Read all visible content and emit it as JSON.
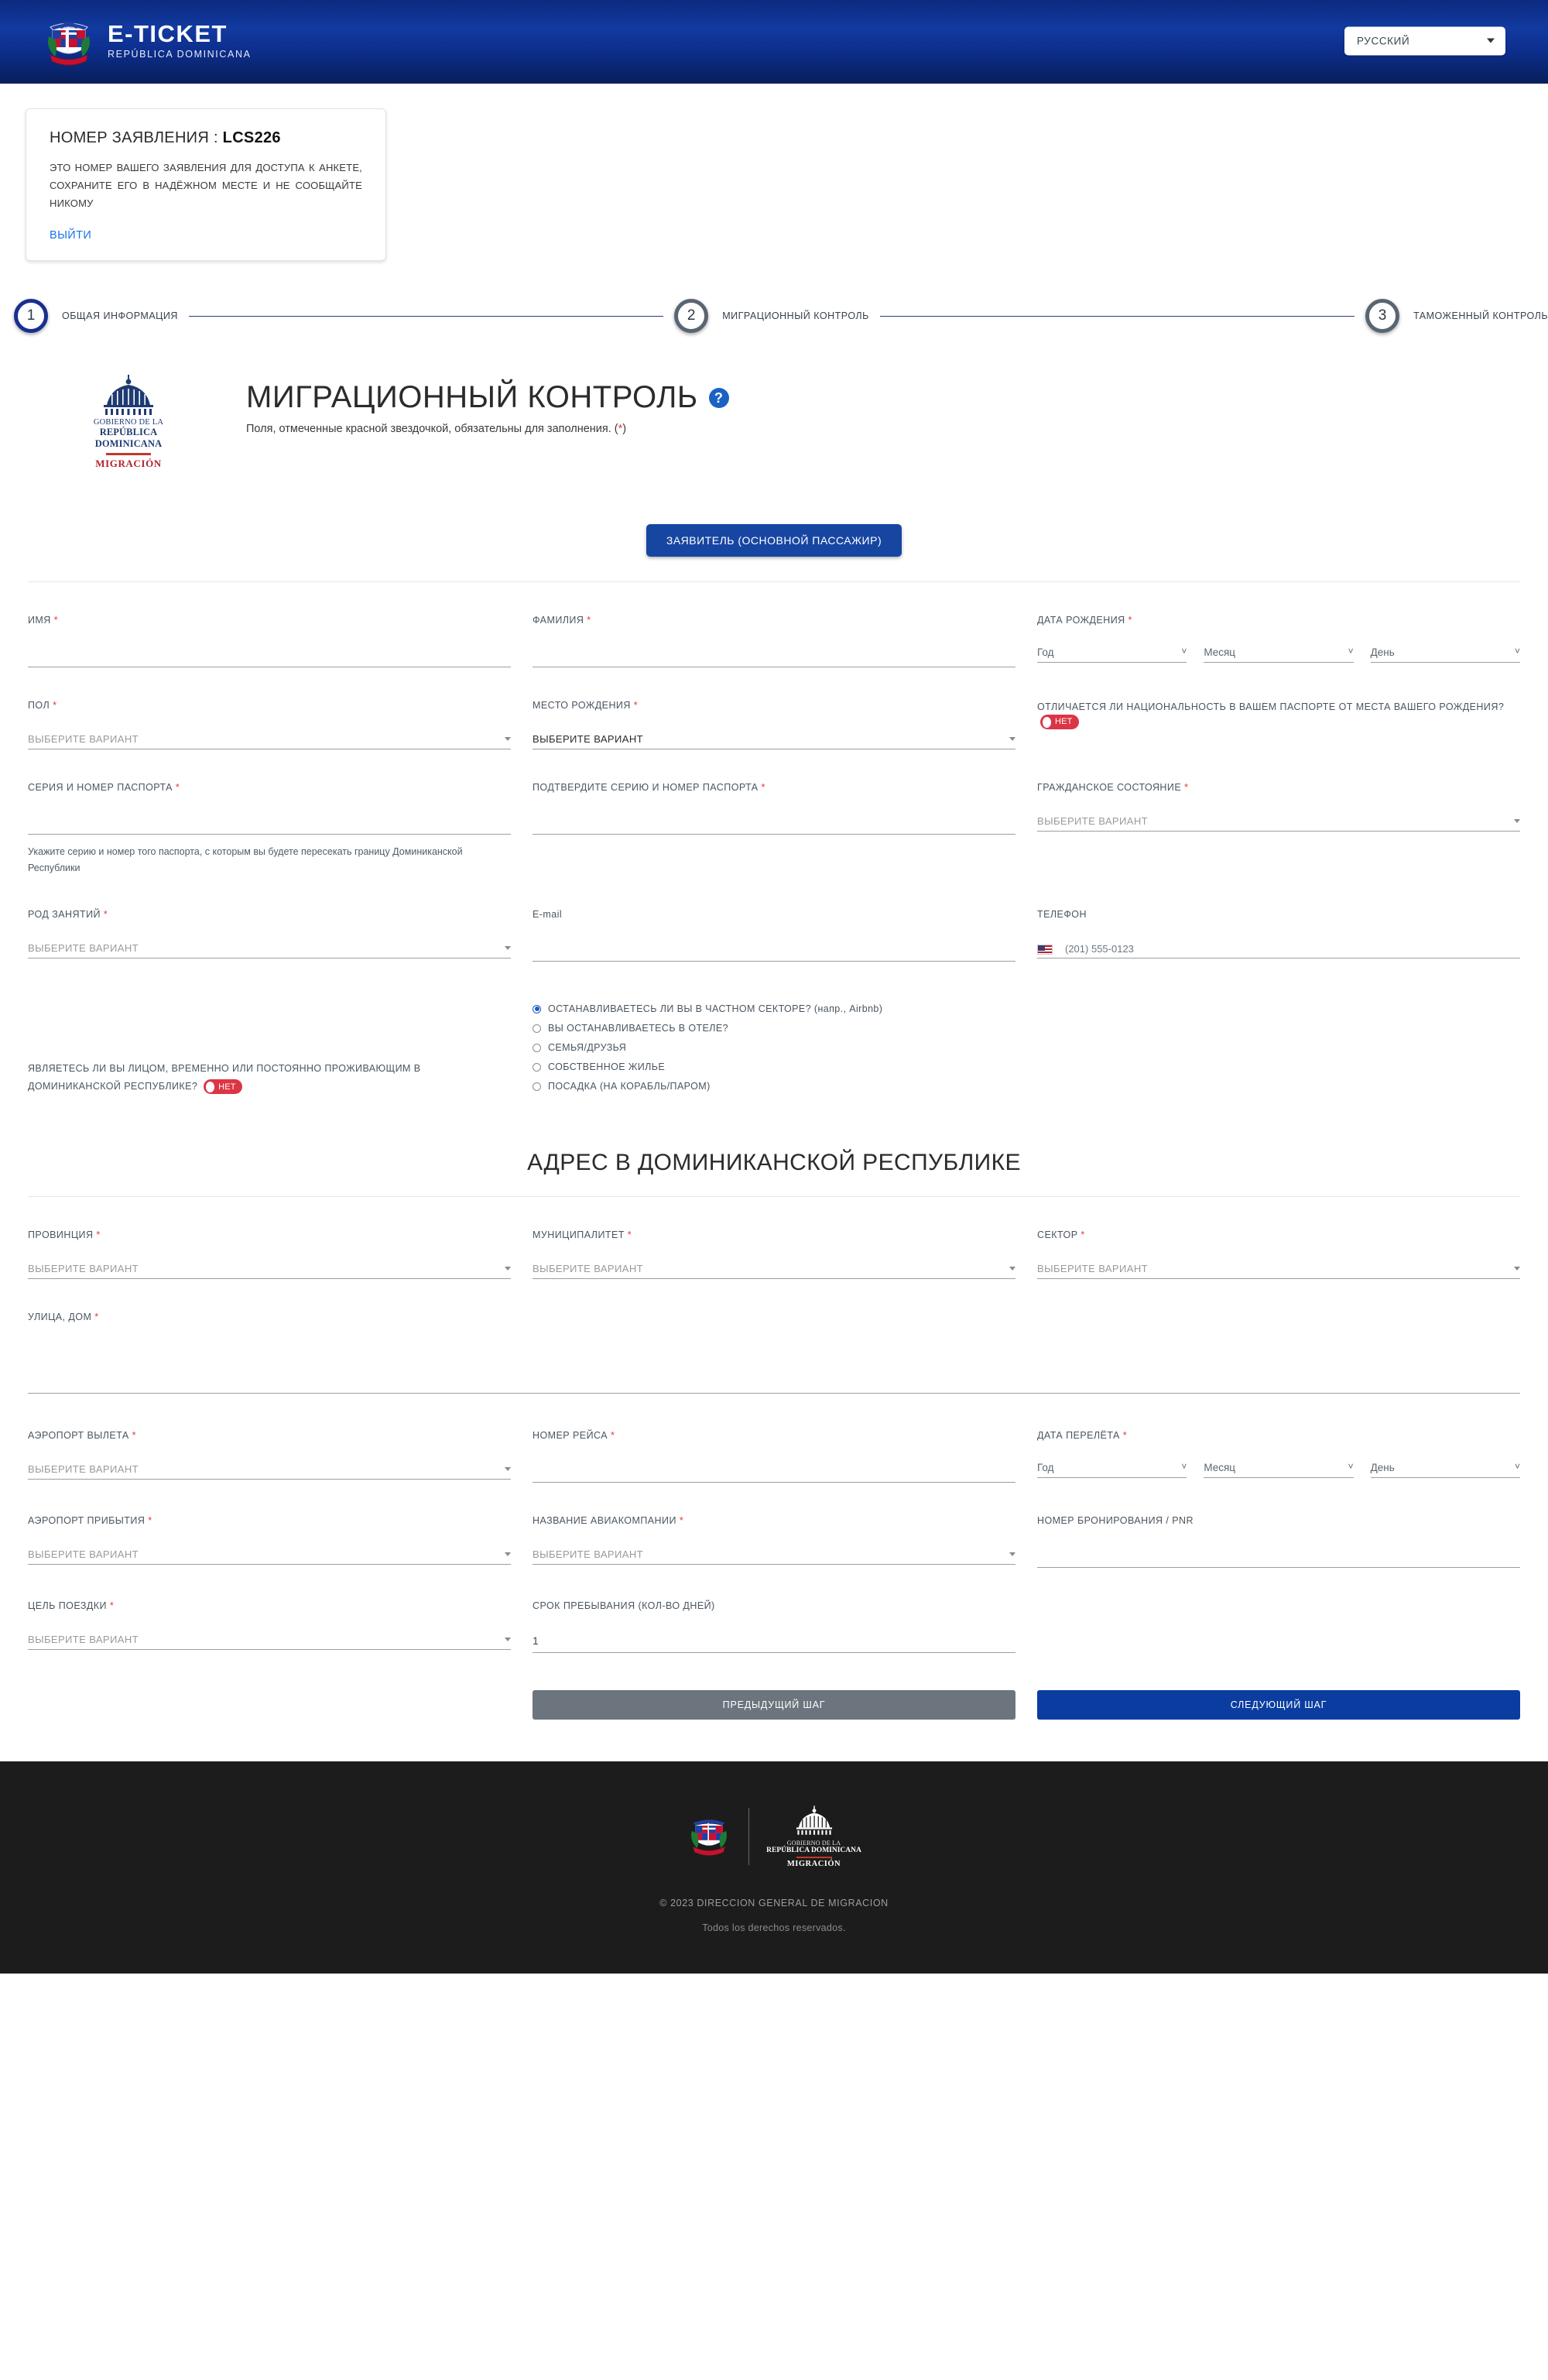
{
  "header": {
    "brand_title": "E-TICKET",
    "brand_subtitle": "REPÚBLICA DOMINICANA",
    "logo_icon": "dominican-coat-of-arms-icon",
    "language": {
      "selected": "РУССКИЙ",
      "caret_icon": "chevron-down-icon"
    },
    "accent_color": "#0b2a80"
  },
  "application_card": {
    "title_prefix": "НОМЕР ЗАЯВЛЕНИЯ : ",
    "application_number": "LCS226",
    "description": "ЭТО НОМЕР ВАШЕГО ЗАЯВЛЕНИЯ ДЛЯ ДОСТУПА К АНКЕТЕ, СОХРАНИТЕ ЕГО В НАДЁЖНОМ МЕСТЕ И НЕ СООБЩАЙТЕ НИКОМУ",
    "logout_label": "ВЫЙТИ",
    "link_color": "#1b74e4"
  },
  "stepper": {
    "steps": [
      {
        "number": "1",
        "label": "ОБЩАЯ ИНФОРМАЦИЯ",
        "state": "active"
      },
      {
        "number": "2",
        "label": "МИГРАЦИОННЫЙ КОНТРОЛЬ",
        "state": "idle"
      },
      {
        "number": "3",
        "label": "ТАМОЖЕННЫЙ КОНТРОЛЬ",
        "state": "idle"
      }
    ],
    "active_color": "#1a2f8f",
    "idle_color": "#5a6572"
  },
  "gov_logo": {
    "line1": "GOBIERNO DE LA",
    "line2": "REPÚBLICA DOMINICANA",
    "line3": "MIGRACIÓN",
    "icon": "capitol-dome-icon",
    "rule_color": "#c0392b",
    "text_color": "#1f3b73"
  },
  "page": {
    "title": "МИГРАЦИОННЫЙ КОНТРОЛЬ",
    "help_icon": "question-mark-icon",
    "subtitle": "Поля, отмеченные красной звездочкой, обязательны для заполнения. (",
    "subtitle_asterisk": "*",
    "subtitle_end": ")"
  },
  "tab": {
    "applicant_label": "ЗАЯВИТЕЛЬ (ОСНОВНОЙ ПАССАЖИР)"
  },
  "form": {
    "select_placeholder": "ВЫБЕРИТЕ ВАРИАНТ",
    "required_mark": "*",
    "first_name": {
      "label": "ИМЯ",
      "value": ""
    },
    "last_name": {
      "label": "ФАМИЛИЯ",
      "value": ""
    },
    "birth_date": {
      "label": "ДАТА РОЖДЕНИЯ",
      "year": "Год",
      "month": "Месяц",
      "day": "День"
    },
    "gender": {
      "label": "ПОЛ",
      "value": "ВЫБЕРИТЕ ВАРИАНТ"
    },
    "birth_place": {
      "label": "МЕСТО РОЖДЕНИЯ",
      "value": "ВЫБЕРИТЕ ВАРИАНТ"
    },
    "nationality_question": {
      "label": "ОТЛИЧАЕТСЯ ЛИ НАЦИОНАЛЬНОСТЬ В ВАШЕМ ПАСПОРТЕ ОТ МЕСТА ВАШЕГО РОЖДЕНИЯ?",
      "toggle_value": "Нет",
      "toggle_color": "#dc3545"
    },
    "passport": {
      "label": "СЕРИЯ И НОМЕР ПАСПОРТА",
      "value": "",
      "hint": "Укажите серию и номер того паспорта, с которым вы будете пересекать границу Доминиканской Республики"
    },
    "passport_confirm": {
      "label": "ПОДТВЕРДИТЕ СЕРИЮ И НОМЕР ПАСПОРТА",
      "value": ""
    },
    "civil_status": {
      "label": "ГРАЖДАНСКОЕ СОСТОЯНИЕ",
      "value": "ВЫБЕРИТЕ ВАРИАНТ"
    },
    "occupation": {
      "label": "РОД ЗАНЯТИЙ",
      "value": "ВЫБЕРИТЕ ВАРИАНТ"
    },
    "email": {
      "label": "E-mail",
      "value": ""
    },
    "phone": {
      "label": "ТЕЛЕФОН",
      "placeholder": "(201) 555-0123",
      "flag_icon": "us-flag-icon",
      "caret_icon": "chevron-down-icon"
    },
    "residency_question": {
      "label": "ЯВЛЯЕТЕСЬ ЛИ ВЫ ЛИЦОМ, ВРЕМЕННО ИЛИ ПОСТОЯННО ПРОЖИВАЮЩИМ В ДОМИНИКАНСКОЙ РЕСПУБЛИКЕ?",
      "toggle_value": "Нет",
      "toggle_color": "#dc3545"
    },
    "stay_options": [
      {
        "label": "ОСТАНАВЛИВАЕТЕСЬ ЛИ ВЫ В ЧАСТНОМ СЕКТОРЕ?",
        "suffix": " (напр., Airbnb)",
        "selected": true
      },
      {
        "label": "ВЫ ОСТАНАВЛИВАЕТЕСЬ В ОТЕЛЕ?",
        "suffix": "",
        "selected": false
      },
      {
        "label": "СЕМЬЯ/ДРУЗЬЯ",
        "suffix": "",
        "selected": false
      },
      {
        "label": "СОБСТВЕННОЕ ЖИЛЬЕ",
        "suffix": "",
        "selected": false
      },
      {
        "label": "ПОСАДКА (НА КОРАБЛЬ/ПАРОМ)",
        "suffix": "",
        "selected": false
      }
    ],
    "address_section_title": "АДРЕС В ДОМИНИКАНСКОЙ РЕСПУБЛИКЕ",
    "province": {
      "label": "ПРОВИНЦИЯ",
      "value": "ВЫБЕРИТЕ ВАРИАНТ"
    },
    "municipality": {
      "label": "МУНИЦИПАЛИТЕТ",
      "value": "ВЫБЕРИТЕ ВАРИАНТ"
    },
    "sector": {
      "label": "СЕКТОР",
      "value": "ВЫБЕРИТЕ ВАРИАНТ"
    },
    "street": {
      "label": "УЛИЦА, ДОМ",
      "value": ""
    },
    "departure_airport": {
      "label": "АЭРОПОРТ ВЫЛЕТА",
      "value": "ВЫБЕРИТЕ ВАРИАНТ"
    },
    "flight_number": {
      "label": "НОМЕР РЕЙСА",
      "value": ""
    },
    "flight_date": {
      "label": "ДАТА ПЕРЕЛЁТА",
      "year": "Год",
      "month": "Месяц",
      "day": "День"
    },
    "arrival_airport": {
      "label": "АЭРОПОРТ ПРИБЫТИЯ",
      "value": "ВЫБЕРИТЕ ВАРИАНТ"
    },
    "airline": {
      "label": "НАЗВАНИЕ АВИАКОМПАНИИ",
      "value": "ВЫБЕРИТЕ ВАРИАНТ"
    },
    "pnr": {
      "label": "НОМЕР БРОНИРОВАНИЯ / PNR",
      "value": ""
    },
    "trip_purpose": {
      "label": "ЦЕЛЬ ПОЕЗДКИ",
      "value": "ВЫБЕРИТЕ ВАРИАНТ"
    },
    "stay_length": {
      "label": "СРОК ПРЕБЫВАНИЯ (КОЛ-ВО ДНЕЙ)",
      "value": "1"
    }
  },
  "nav": {
    "prev_label": "ПРЕДЫДУЩИЙ ШАГ",
    "next_label": "СЛЕДУЮЩИЙ ШАГ",
    "prev_color": "#6c757d",
    "next_color": "#0b3da1"
  },
  "footer": {
    "coat_icon": "dominican-coat-of-arms-icon",
    "gov_line1": "GOBIERNO DE LA",
    "gov_line2": "REPÚBLICA DOMINICANA",
    "gov_line3": "MIGRACIÓN",
    "copyright": "© 2023 DIRECCION GENERAL DE MIGRACION",
    "rights": "Todos los derechos reservados."
  }
}
